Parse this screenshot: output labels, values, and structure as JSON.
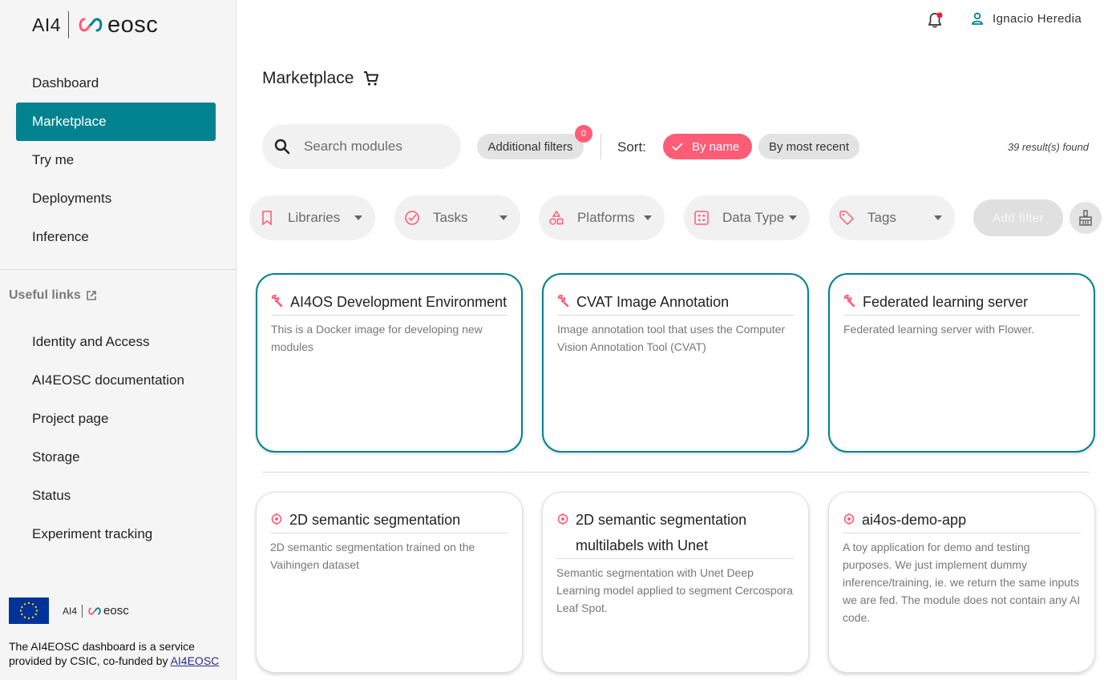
{
  "brand": {
    "ai4": "AI4",
    "eosc": "eosc"
  },
  "sidebar": {
    "nav": [
      {
        "label": "Dashboard",
        "active": false
      },
      {
        "label": "Marketplace",
        "active": true
      },
      {
        "label": "Try me",
        "active": false
      },
      {
        "label": "Deployments",
        "active": false
      },
      {
        "label": "Inference",
        "active": false
      }
    ],
    "useful_links_title": "Useful links",
    "links": [
      {
        "label": "Identity and Access"
      },
      {
        "label": "AI4EOSC documentation"
      },
      {
        "label": "Project page"
      },
      {
        "label": "Storage"
      },
      {
        "label": "Status"
      },
      {
        "label": "Experiment tracking"
      }
    ],
    "footer_text": "The AI4EOSC dashboard is a service provided by CSIC, co-funded by",
    "footer_link": "AI4EOSC"
  },
  "header": {
    "user_name": "Ignacio Heredia",
    "notification_dot_color": "#f21d34"
  },
  "page": {
    "title": "Marketplace",
    "title_icon": "cart-icon"
  },
  "toolbar": {
    "search_placeholder": "Search modules",
    "additional_filters_label": "Additional filters",
    "additional_filters_count": "0",
    "sort_label": "Sort:",
    "sort_by_name": "By name",
    "sort_by_recent": "By most recent",
    "results": "39 result(s) found"
  },
  "filters": [
    {
      "label": "Libraries",
      "icon": "bookmark-icon"
    },
    {
      "label": "Tasks",
      "icon": "check-circle-icon"
    },
    {
      "label": "Platforms",
      "icon": "shapes-icon"
    },
    {
      "label": "Data Type",
      "icon": "grid-icon"
    },
    {
      "label": "Tags",
      "icon": "tag-icon"
    }
  ],
  "add_filter_label": "Add filter",
  "dev_cards": [
    {
      "title": "AI4OS Development Environment",
      "description": "This is a Docker image for developing new modules",
      "icon": "wrench-icon"
    },
    {
      "title": "CVAT Image Annotation",
      "description": "Image annotation tool that uses the Computer Vision Annotation Tool (CVAT)",
      "icon": "wrench-icon"
    },
    {
      "title": "Federated learning server",
      "description": "Federated learning server with Flower.",
      "icon": "wrench-icon"
    }
  ],
  "module_cards": [
    {
      "title": "2D semantic segmentation",
      "description": "2D semantic segmentation trained on the Vaihingen dataset",
      "icon": "brain-icon"
    },
    {
      "title": "2D semantic segmentation multilabels with Unet",
      "description": "Semantic segmentation with Unet Deep Learning model applied to segment Cercospora Leaf Spot.",
      "icon": "brain-icon"
    },
    {
      "title": "ai4os-demo-app",
      "description": "A toy application for demo and testing purposes. We just implement dummy inference/training, ie. we return the same inputs we are fed. The module does not contain any AI code.",
      "icon": "brain-icon"
    }
  ],
  "colors": {
    "accent": "#00838f",
    "pink": "#ff5c77",
    "sidebar_bg": "#f5f5f5"
  }
}
